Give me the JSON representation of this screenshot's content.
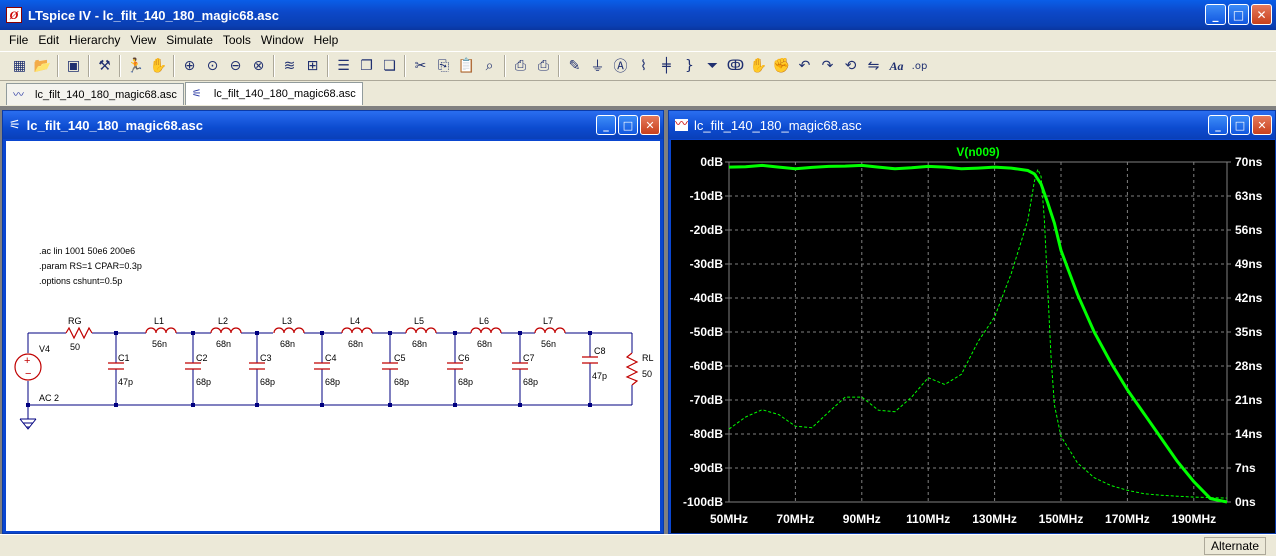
{
  "app": {
    "title": "LTspice IV - lc_filt_140_180_magic68.asc"
  },
  "menu": [
    "File",
    "Edit",
    "Hierarchy",
    "View",
    "Simulate",
    "Tools",
    "Window",
    "Help"
  ],
  "toolbar": {
    "icons": [
      "new-schematic-icon",
      "open-icon",
      "save-icon",
      "control-panel-icon",
      "run-icon",
      "halt-icon",
      "zoom-in-icon",
      "pan-icon",
      "zoom-out-icon",
      "zoom-fit-icon",
      "autorange-icon",
      "grid-icon",
      "tile-horizontal-icon",
      "cascade-icon",
      "tile-vertical-icon",
      "cut-icon",
      "copy-icon",
      "paste-icon",
      "find-icon",
      "print-setup-icon",
      "print-icon",
      "draw-wire-icon",
      "ground-icon",
      "label-net-icon",
      "resistor-icon",
      "capacitor-icon",
      "inductor-icon",
      "diode-icon",
      "component-icon",
      "move-icon",
      "drag-icon",
      "undo-icon",
      "redo-icon",
      "rotate-icon",
      "mirror-icon",
      "text-icon",
      "spice-directive-icon"
    ]
  },
  "tabs": [
    {
      "label": "lc_filt_140_180_magic68.asc",
      "icon": "waveform-icon",
      "active": false
    },
    {
      "label": "lc_filt_140_180_magic68.asc",
      "icon": "schematic-icon",
      "active": true
    }
  ],
  "schematic": {
    "title": "lc_filt_140_180_magic68.asc",
    "directives": [
      ".ac lin 1001 50e6 200e6",
      ".param RS=1 CPAR=0.3p",
      ".options cshunt=0.5p"
    ],
    "source": {
      "name": "V4",
      "value": "AC 2"
    },
    "rg": {
      "name": "RG",
      "value": "50"
    },
    "rl": {
      "name": "RL",
      "value": "50"
    },
    "inductors": [
      {
        "name": "L1",
        "value": "56n"
      },
      {
        "name": "L2",
        "value": "68n"
      },
      {
        "name": "L3",
        "value": "68n"
      },
      {
        "name": "L4",
        "value": "68n"
      },
      {
        "name": "L5",
        "value": "68n"
      },
      {
        "name": "L6",
        "value": "68n"
      },
      {
        "name": "L7",
        "value": "56n"
      }
    ],
    "capacitors": [
      {
        "name": "C1",
        "value": "47p"
      },
      {
        "name": "C2",
        "value": "68p"
      },
      {
        "name": "C3",
        "value": "68p"
      },
      {
        "name": "C4",
        "value": "68p"
      },
      {
        "name": "C5",
        "value": "68p"
      },
      {
        "name": "C6",
        "value": "68p"
      },
      {
        "name": "C7",
        "value": "68p"
      },
      {
        "name": "C8",
        "value": "47p"
      }
    ],
    "colors": {
      "wire": "#000080",
      "component": "#c00000",
      "text": "#000000"
    }
  },
  "waveform": {
    "title": "lc_filt_140_180_magic68.asc",
    "trace_label": "V(n009)",
    "colors": {
      "background": "#000000",
      "trace": "#00ff00",
      "grid": "#808080",
      "axis_text": "#ffffff"
    }
  },
  "chart_data": {
    "type": "line",
    "title": "V(n009)",
    "xlabel": "",
    "ylabel": "",
    "xlim": [
      50,
      200
    ],
    "ylim": [
      -100,
      0
    ],
    "y2lim": [
      0,
      70
    ],
    "x_ticks": [
      "50MHz",
      "70MHz",
      "90MHz",
      "110MHz",
      "130MHz",
      "150MHz",
      "170MHz",
      "190MHz"
    ],
    "y_ticks": [
      "0dB",
      "-10dB",
      "-20dB",
      "-30dB",
      "-40dB",
      "-50dB",
      "-60dB",
      "-70dB",
      "-80dB",
      "-90dB",
      "-100dB"
    ],
    "y2_ticks": [
      "70ns",
      "63ns",
      "56ns",
      "49ns",
      "42ns",
      "35ns",
      "28ns",
      "21ns",
      "14ns",
      "7ns",
      "0ns"
    ],
    "grid": true,
    "series": [
      {
        "style": "solid",
        "axis": "left",
        "x": [
          50,
          55,
          60,
          65,
          70,
          75,
          80,
          85,
          90,
          95,
          100,
          105,
          110,
          115,
          120,
          125,
          130,
          135,
          140,
          142,
          144,
          146,
          148,
          150,
          155,
          160,
          165,
          170,
          175,
          180,
          185,
          190,
          195,
          200
        ],
        "y": [
          -1.5,
          -1.4,
          -1.0,
          -1.5,
          -2.0,
          -1.6,
          -1.3,
          -1.2,
          -1.0,
          -1.5,
          -2.0,
          -1.7,
          -1.3,
          -1.5,
          -2.0,
          -1.8,
          -1.5,
          -1.8,
          -2.5,
          -3.5,
          -6.5,
          -12,
          -18,
          -26,
          -39,
          -50,
          -59,
          -67,
          -74,
          -81,
          -88,
          -94,
          -99,
          -100
        ]
      },
      {
        "style": "dashed",
        "axis": "right",
        "x": [
          50,
          55,
          60,
          65,
          70,
          75,
          80,
          85,
          90,
          95,
          100,
          105,
          110,
          115,
          120,
          125,
          130,
          135,
          140,
          142,
          143,
          144,
          145,
          146,
          147,
          148,
          150,
          155,
          160,
          165,
          170,
          175,
          180,
          185,
          190,
          195,
          200
        ],
        "y": [
          15,
          17.5,
          19,
          18.0,
          15.6,
          15.3,
          18.5,
          21.6,
          21.6,
          18.9,
          18.6,
          21.6,
          25.6,
          24.2,
          26.3,
          33.0,
          38.1,
          47.0,
          58.0,
          66.0,
          68.5,
          67.0,
          58.0,
          44.0,
          30.0,
          20.0,
          13.5,
          8.0,
          5.0,
          3.4,
          2.4,
          1.7,
          1.4,
          1.2,
          1.0,
          0.9,
          0.8
        ]
      }
    ]
  },
  "status": {
    "text": "Alternate"
  }
}
